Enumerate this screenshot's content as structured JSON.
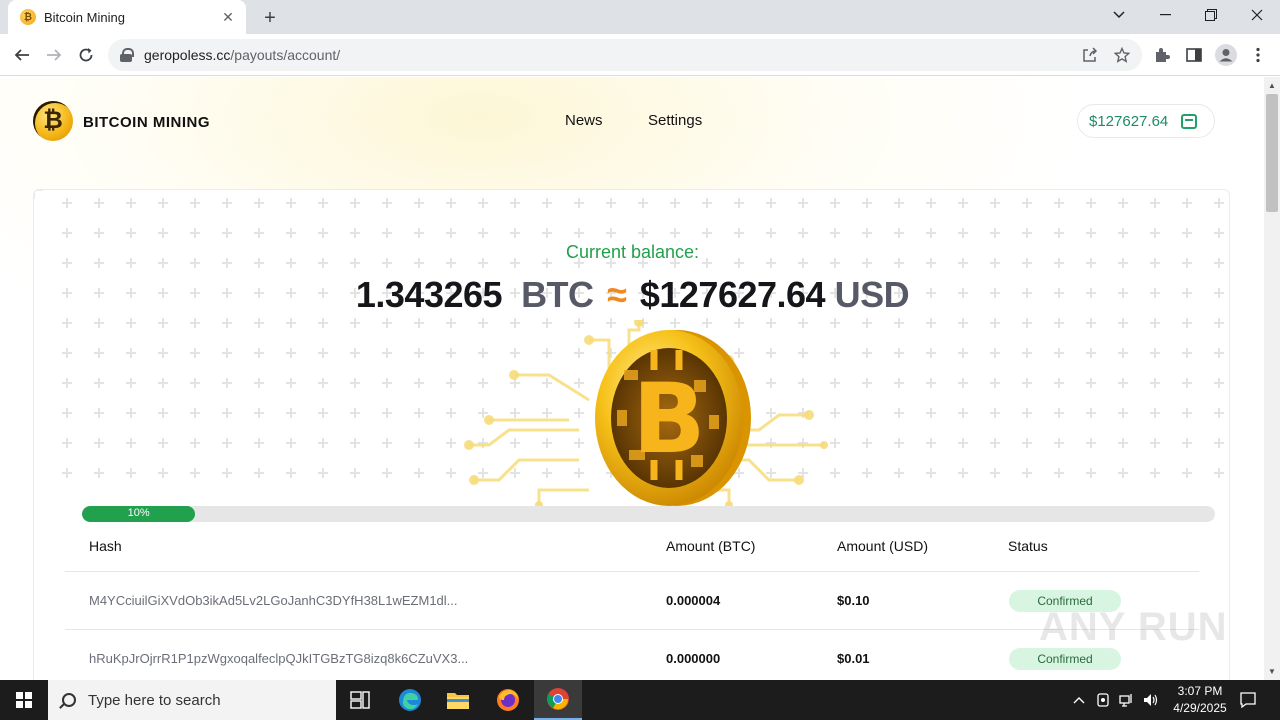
{
  "browser": {
    "tab_title": "Bitcoin Mining",
    "tab_favicon_glyph": "₿",
    "new_tab_glyph": "+",
    "close_glyph": "✕",
    "url_host": "geropoless.cc",
    "url_path": "/payouts/account/"
  },
  "site": {
    "name": "BITCOIN MINING",
    "logo_glyph": "₿",
    "nav": [
      "News",
      "Settings"
    ],
    "header_balance": "$127627.64"
  },
  "balance": {
    "label": "Current balance:",
    "btc_amount": "1.343265",
    "btc_unit": "BTC",
    "approx": "≈",
    "usd_amount": "$127627.64",
    "usd_unit": "USD"
  },
  "progress": {
    "value_pct": 10,
    "label": "10%"
  },
  "table": {
    "headers": [
      "Hash",
      "Amount (BTC)",
      "Amount (USD)",
      "Status"
    ],
    "rows": [
      {
        "hash": "M4YCciuilGiXVdOb3ikAd5Lv2LGoJanhC3DYfH38L1wEZM1dl...",
        "btc": "0.000004",
        "usd": "$0.10",
        "status": "Confirmed"
      },
      {
        "hash": "hRuKpJrOjrrR1P1pzWgxoqalfeclpQJkITGBzTG8izq8k6CZuVX3...",
        "btc": "0.000000",
        "usd": "$0.01",
        "status": "Confirmed"
      }
    ]
  },
  "watermark": "ANY RUN",
  "taskbar": {
    "search_placeholder": "Type here to search",
    "time": "3:07 PM",
    "date": "4/29/2025"
  },
  "colors": {
    "accent_green": "#21a04d",
    "balance_green": "#22a04a",
    "approx_orange": "#f08a1c",
    "badge_bg": "#d8f5e1"
  }
}
